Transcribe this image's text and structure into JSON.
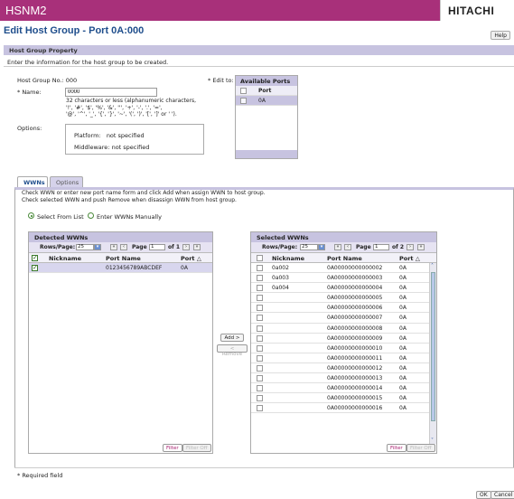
{
  "header": {
    "app_title": "HSNM2",
    "brand": "HITACHI"
  },
  "page": {
    "title": "Edit Host Group  - Port 0A:000",
    "help_label": "Help"
  },
  "property": {
    "section_title": "Host Group Property",
    "instruction": "Enter the information for the host group to be created.",
    "host_group_no_label": "Host Group No.: 000",
    "name_label": "* Name:",
    "name_value": "0000",
    "name_note": [
      "32 characters or less (alphanumeric characters,",
      "'!', '#', '$', '%', '&', ''', '+', '-', '.', '=',",
      "'@', '^', '_', '{', '}', '~', '(', ')', '[', ']' or ' ')."
    ],
    "options_label": "Options:",
    "platform_label": "Platform:",
    "platform_value": "not specified",
    "middleware_label": "Middleware:",
    "middleware_value": "not specified",
    "edit_to_label": "* Edit to:",
    "available_ports": {
      "title": "Available Ports",
      "column": "Port",
      "rows": [
        "0A"
      ]
    }
  },
  "tabs": [
    {
      "label": "WWNs"
    },
    {
      "label": "Options"
    }
  ],
  "wwns": {
    "instructions": [
      "Check WWN or enter new port name form and click Add when assign WWN to host group.",
      "Check selected WWN and push Remove when disassign WWN from host group."
    ],
    "radio_list": "Select From List",
    "radio_manual": "Enter WWNs Manually",
    "detected": {
      "title": "Detected WWNs",
      "rows_label": "Rows/Page:",
      "rows_value": "25",
      "page_label": "Page",
      "page_value": "1",
      "of_label": "of 1",
      "columns": [
        "Nickname",
        "Port Name",
        "Port"
      ],
      "rows": [
        {
          "nickname": "",
          "port_name": "0123456789ABCDEF",
          "port": "0A"
        }
      ],
      "filter": "Filter",
      "filter_off": "Filter Off"
    },
    "add_label": "Add >",
    "remove_label": "< Remove",
    "selected": {
      "title": "Selected WWNs",
      "rows_label": "Rows/Page:",
      "rows_value": "25",
      "page_label": "Page",
      "page_value": "1",
      "of_label": "of 2",
      "columns": [
        "Nickname",
        "Port Name",
        "Port"
      ],
      "rows": [
        {
          "nickname": "0a002",
          "port_name": "0A00000000000002",
          "port": "0A"
        },
        {
          "nickname": "0a003",
          "port_name": "0A00000000000003",
          "port": "0A"
        },
        {
          "nickname": "0a004",
          "port_name": "0A00000000000004",
          "port": "0A"
        },
        {
          "nickname": "",
          "port_name": "0A00000000000005",
          "port": "0A"
        },
        {
          "nickname": "",
          "port_name": "0A00000000000006",
          "port": "0A"
        },
        {
          "nickname": "",
          "port_name": "0A00000000000007",
          "port": "0A"
        },
        {
          "nickname": "",
          "port_name": "0A00000000000008",
          "port": "0A"
        },
        {
          "nickname": "",
          "port_name": "0A00000000000009",
          "port": "0A"
        },
        {
          "nickname": "",
          "port_name": "0A00000000000010",
          "port": "0A"
        },
        {
          "nickname": "",
          "port_name": "0A00000000000011",
          "port": "0A"
        },
        {
          "nickname": "",
          "port_name": "0A00000000000012",
          "port": "0A"
        },
        {
          "nickname": "",
          "port_name": "0A00000000000013",
          "port": "0A"
        },
        {
          "nickname": "",
          "port_name": "0A00000000000014",
          "port": "0A"
        },
        {
          "nickname": "",
          "port_name": "0A00000000000015",
          "port": "0A"
        },
        {
          "nickname": "",
          "port_name": "0A00000000000016",
          "port": "0A"
        }
      ],
      "filter": "Filter",
      "filter_off": "Filter Off"
    }
  },
  "footer": {
    "required_note": "* Required field",
    "ok_label": "OK",
    "cancel_label": "Cancel"
  },
  "colors": {
    "header_bg": "#a8307a",
    "section_bg": "#c7c3e0",
    "title_color": "#1f4e8c"
  }
}
